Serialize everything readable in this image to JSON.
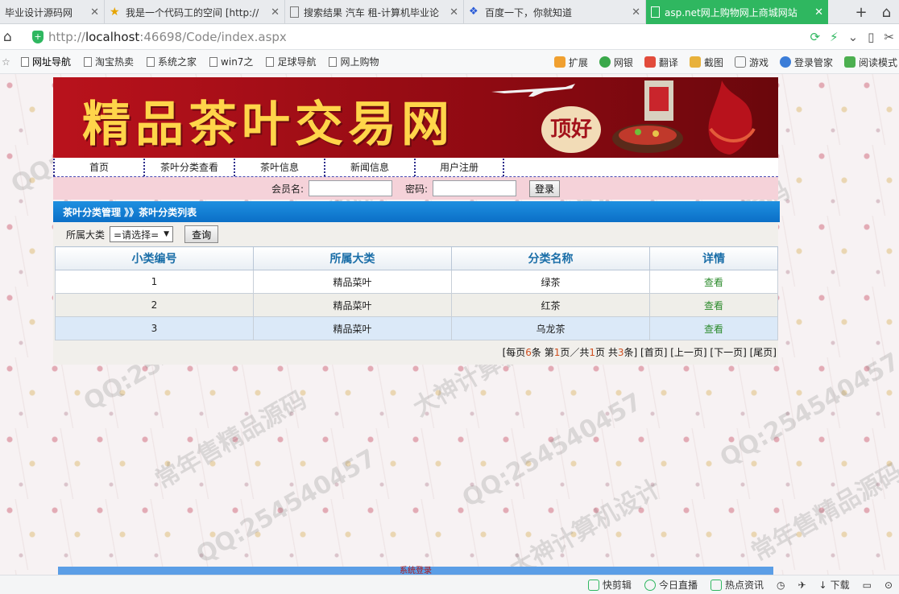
{
  "browser": {
    "tabs": [
      {
        "label": "毕业设计源码网",
        "active": false
      },
      {
        "label": "我是一个代码工的空间 [http://",
        "active": false
      },
      {
        "label": "搜索结果 汽车 租-计算机毕业论",
        "active": false
      },
      {
        "label": "百度一下，你就知道",
        "active": false
      },
      {
        "label": "asp.net网上购物网上商城网站",
        "active": true
      }
    ],
    "url_prefix": "http://",
    "url_host": "localhost",
    "url_rest": ":46698/Code/index.aspx",
    "bookmarks": [
      "网址导航",
      "淘宝热卖",
      "系统之家",
      "win7之",
      "足球导航",
      "网上购物"
    ],
    "toolbar_right": [
      "扩展",
      "网银",
      "翻译",
      "截图",
      "游戏",
      "登录管家",
      "阅读模式"
    ],
    "status_items": [
      "快剪辑",
      "今日直播",
      "热点资讯",
      "下载"
    ]
  },
  "page": {
    "banner_title": "精品茶叶交易网",
    "banner_badge": "顶好",
    "nav": [
      "首页",
      "茶叶分类查看",
      "茶叶信息",
      "新闻信息",
      "用户注册"
    ],
    "login": {
      "member_label": "会员名:",
      "password_label": "密码:",
      "member_value": "",
      "password_value": "",
      "button": "登录"
    },
    "breadcrumb": "茶叶分类管理 》》茶叶分类列表",
    "filter": {
      "label": "所属大类",
      "selected": "=请选择=",
      "button": "查询"
    },
    "table": {
      "headers": [
        "小类编号",
        "所属大类",
        "分类名称",
        "详情"
      ],
      "rows": [
        {
          "id": "1",
          "category": "精品菜叶",
          "name": "绿茶",
          "action": "查看"
        },
        {
          "id": "2",
          "category": "精品菜叶",
          "name": "红茶",
          "action": "查看"
        },
        {
          "id": "3",
          "category": "精品菜叶",
          "name": "乌龙茶",
          "action": "查看"
        }
      ]
    },
    "pager": {
      "p1": "[每页",
      "per_page": "6",
      "p2": "条 第",
      "current": "1",
      "p3": "页／共",
      "total_pages": "1",
      "p4": "页 共",
      "total": "3",
      "p5": "条]",
      "first": "[首页]",
      "prev": "[上一页]",
      "next": "[下一页]",
      "last": "[尾页]"
    },
    "footer_text": "系统登录"
  },
  "watermarks": [
    "QQ:254540457",
    "大神计算机设计",
    "常年售精品源码"
  ],
  "colors": {
    "active_tab": "#2fb760",
    "banner_red": "#b9121c",
    "banner_text": "#ffd54a",
    "crumb_blue": "#1e90e0",
    "header_text": "#1a6ea8",
    "view_link": "#2b8a2b"
  }
}
